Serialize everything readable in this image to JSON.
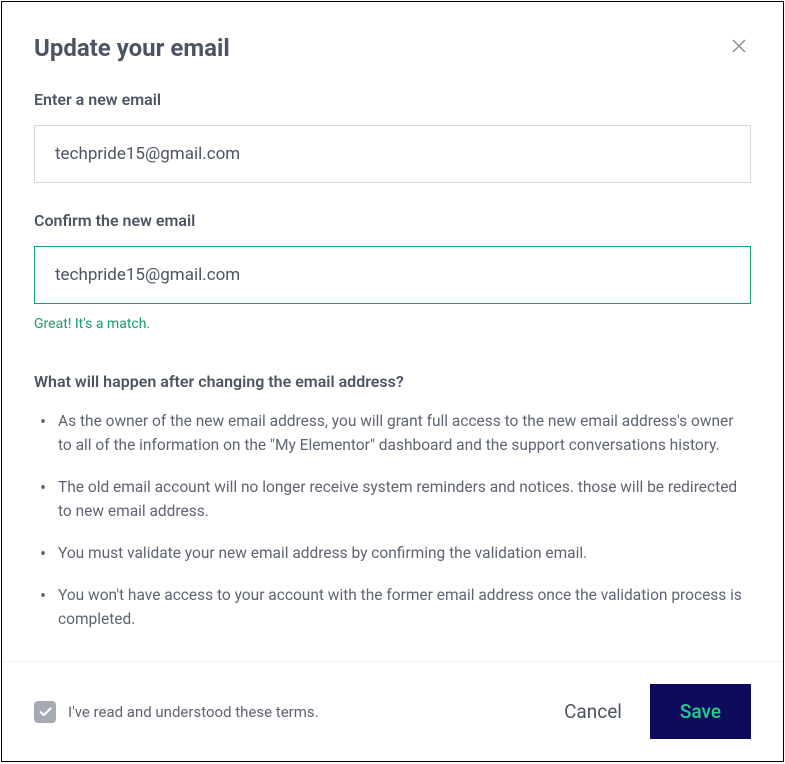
{
  "modal": {
    "title": "Update your email"
  },
  "form": {
    "new_email_label": "Enter a new email",
    "new_email_value": "techpride15@gmail.com",
    "confirm_email_label": "Confirm the new email",
    "confirm_email_value": "techpride15@gmail.com",
    "validation_message": "Great! It's a match."
  },
  "info": {
    "heading": "What will happen after changing the email address?",
    "items": [
      "As the owner of the new email address, you will grant full access to the new email address's owner to all of the information on the \"My Elementor\" dashboard and the support conversations history.",
      "The old email account will no longer receive system reminders and notices. those will be redirected to new email address.",
      "You must validate your new email address by confirming the validation email.",
      "You won't have access to your account with the former email address once the validation process is completed."
    ]
  },
  "footer": {
    "terms_label": "I've read and understood these terms.",
    "cancel_label": "Cancel",
    "save_label": "Save"
  }
}
